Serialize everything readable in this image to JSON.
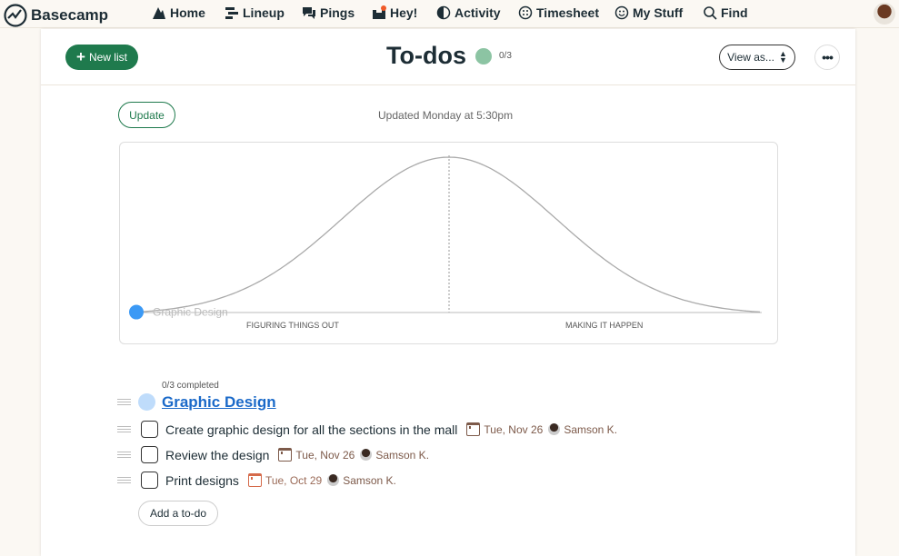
{
  "nav": {
    "brand": "Basecamp",
    "items": [
      {
        "label": "Home",
        "icon": "mountain-icon"
      },
      {
        "label": "Lineup",
        "icon": "lineup-icon"
      },
      {
        "label": "Pings",
        "icon": "chat-bubbles-icon"
      },
      {
        "label": "Hey!",
        "icon": "inbox-icon",
        "has_notification": true
      },
      {
        "label": "Activity",
        "icon": "half-circle-icon"
      },
      {
        "label": "Timesheet",
        "icon": "timesheet-icon"
      },
      {
        "label": "My Stuff",
        "icon": "smiley-icon"
      },
      {
        "label": "Find",
        "icon": "search-icon"
      }
    ]
  },
  "header": {
    "new_list": "New list",
    "title": "To-dos",
    "progress": "0/3",
    "view_as": "View as...",
    "more": "•••"
  },
  "hill": {
    "update": "Update",
    "updated": "Updated Monday at 5:30pm",
    "phase_left": "FIGURING THINGS OUT",
    "phase_right": "MAKING IT HAPPEN",
    "dots": [
      {
        "label": "Graphic Design",
        "position_percent": 0,
        "color": "#3b99f5"
      }
    ]
  },
  "list": {
    "completed": "0/3 completed",
    "name": "Graphic Design",
    "color": "#bfdcfb",
    "todos": [
      {
        "text": "Create graphic design for all the sections in the mall",
        "due": "Tue, Nov 26",
        "assignee": "Samson K.",
        "overdue": false
      },
      {
        "text": "Review the design",
        "due": "Tue, Nov 26",
        "assignee": "Samson K.",
        "overdue": false
      },
      {
        "text": "Print designs",
        "due": "Tue, Oct 29",
        "assignee": "Samson K.",
        "overdue": true
      }
    ],
    "add_todo": "Add a to-do"
  },
  "colors": {
    "accent": "#1f7a4d",
    "link": "#1b6ac9",
    "background": "#fbf8f3"
  }
}
